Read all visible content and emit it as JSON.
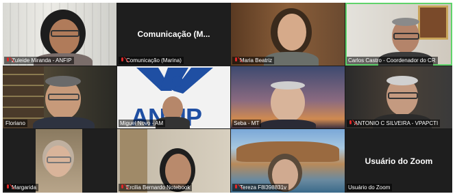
{
  "participants": [
    {
      "name": "Zuleide Miranda - ANFIP",
      "muted": true,
      "video": true
    },
    {
      "name": "Comunicação (Marina)",
      "display": "Comunicação  (M...",
      "muted": true,
      "video": false
    },
    {
      "name": "Maria Beatriz",
      "muted": true,
      "video": true
    },
    {
      "name": "Carlos Castro - Coordenador do CR",
      "muted": false,
      "video": true,
      "active": true
    },
    {
      "name": "Floriano",
      "muted": false,
      "video": true
    },
    {
      "name": "Miguel Novo - AM",
      "muted": false,
      "video": true
    },
    {
      "name": "Seba - MT",
      "muted": false,
      "video": true
    },
    {
      "name": "ANTONIO C SILVEIRA - VPAPCTI",
      "muted": true,
      "video": true
    },
    {
      "name": "Margarida",
      "muted": true,
      "video": true
    },
    {
      "name": "Ercilia Bernardo Notebook",
      "muted": true,
      "video": true
    },
    {
      "name": "Tereza F8l398831v",
      "muted": true,
      "video": true
    },
    {
      "name": "Usuário do Zoom",
      "display": "Usuário do Zoom",
      "muted": false,
      "video": false
    }
  ],
  "logo_text": "ANFIP",
  "colors": {
    "active_border": "#5fd36a",
    "mic_muted": "#e02828",
    "logo_blue": "#1f4fa3"
  }
}
